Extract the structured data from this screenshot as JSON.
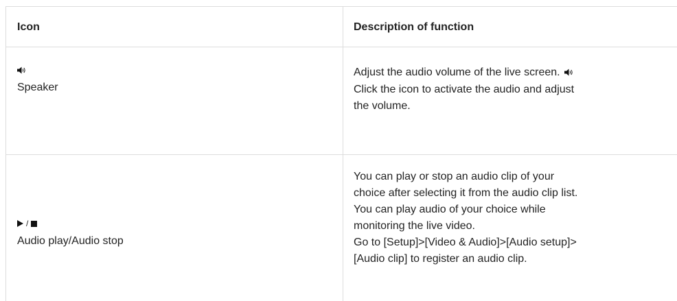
{
  "table": {
    "headers": {
      "icon": "Icon",
      "description": "Description of function"
    },
    "rows": [
      {
        "icon_name": "speaker-icon",
        "icon_label": "Speaker",
        "description_lines": [
          "Adjust the audio volume of the live screen.",
          "Click the icon to activate the audio and adjust",
          "the volume."
        ]
      },
      {
        "icon_names": [
          "play-icon",
          "stop-icon"
        ],
        "icon_separator": "/",
        "icon_label": "Audio play/Audio stop",
        "description_lines": [
          "You can play or stop an audio clip of your",
          "choice after selecting it from the audio clip list.",
          "You can play audio of your choice while",
          "monitoring the live video.",
          "Go to [Setup]>[Video & Audio]>[Audio setup]>",
          "[Audio clip] to register an audio clip."
        ]
      }
    ]
  }
}
